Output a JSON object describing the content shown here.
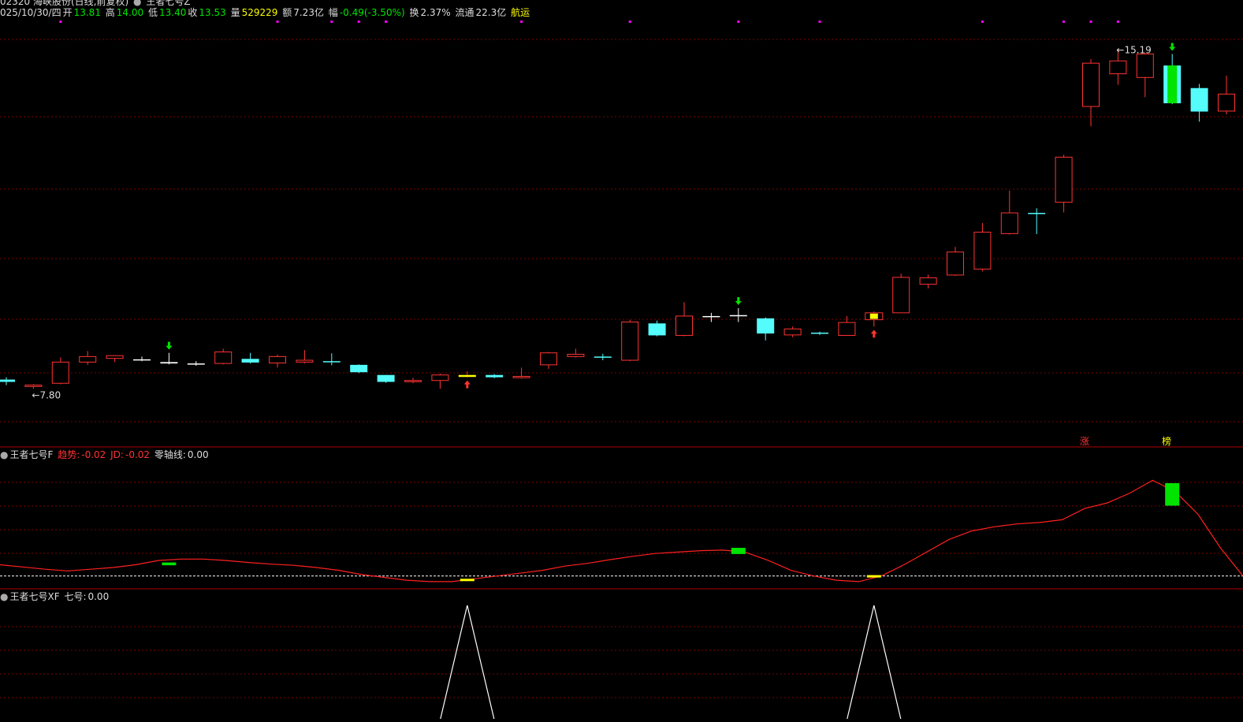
{
  "colors": {
    "up": "#ff3333",
    "down": "#54fcfc",
    "flat": "#ffffff",
    "green": "#00e400",
    "yellow": "#ffff00",
    "magenta": "#ff00ff",
    "grid": "#7a0000",
    "white": "#ffffff"
  },
  "header": {
    "code_title": "02320 海峡股份(日线,前复权)",
    "indicator_title": "王者七号Z",
    "date": "025/10/30/四",
    "open_label": "开",
    "open": "13.81",
    "high_label": "高",
    "high": "14.00",
    "low_label": "低",
    "low": "13.40",
    "close_label": "收",
    "close": "13.53",
    "vol_label": "量",
    "vol": "529229",
    "amt_label": "额",
    "amt": "7.23亿",
    "chg_label": "幅",
    "chg": "-0.49(-3.50%)",
    "turn_label": "换",
    "turn": "2.37%",
    "float_label": "流通",
    "float": "22.3亿",
    "sector": "航运"
  },
  "main_labels": {
    "max": "15.19",
    "min": "7.80",
    "tag1": "涨",
    "tag2": "榜"
  },
  "panel2": {
    "name": "王者七号F",
    "trend_label": "趋势:",
    "trend": "-0.02",
    "jd_label": "JD:",
    "jd": "-0.02",
    "zero_label": "零轴线:",
    "zero": "0.00"
  },
  "panel3": {
    "name": "王者七号XF",
    "qh_label": "七号:",
    "qh": "0.00"
  },
  "chart_data": {
    "type": "candlestick",
    "price_range": [
      7.0,
      15.9
    ],
    "candles": [
      {
        "o": 8.0,
        "h": 8.05,
        "l": 7.88,
        "c": 7.95,
        "color": "down"
      },
      {
        "o": 7.85,
        "h": 7.9,
        "l": 7.8,
        "c": 7.88,
        "color": "up"
      },
      {
        "o": 7.92,
        "h": 8.48,
        "l": 7.9,
        "c": 8.38,
        "color": "up"
      },
      {
        "o": 8.38,
        "h": 8.62,
        "l": 8.32,
        "c": 8.5,
        "color": "up"
      },
      {
        "o": 8.46,
        "h": 8.52,
        "l": 8.38,
        "c": 8.52,
        "color": "up"
      },
      {
        "o": 8.44,
        "h": 8.5,
        "l": 8.4,
        "c": 8.42,
        "color": "flat"
      },
      {
        "o": 8.38,
        "h": 8.58,
        "l": 8.33,
        "c": 8.35,
        "color": "green_cross"
      },
      {
        "o": 8.35,
        "h": 8.4,
        "l": 8.3,
        "c": 8.35,
        "color": "flat"
      },
      {
        "o": 8.35,
        "h": 8.67,
        "l": 8.33,
        "c": 8.6,
        "color": "up"
      },
      {
        "o": 8.45,
        "h": 8.58,
        "l": 8.35,
        "c": 8.37,
        "color": "down"
      },
      {
        "o": 8.36,
        "h": 8.54,
        "l": 8.26,
        "c": 8.5,
        "color": "up"
      },
      {
        "o": 8.38,
        "h": 8.64,
        "l": 8.35,
        "c": 8.42,
        "color": "up"
      },
      {
        "o": 8.4,
        "h": 8.57,
        "l": 8.31,
        "c": 8.38,
        "color": "down"
      },
      {
        "o": 8.32,
        "h": 8.33,
        "l": 8.14,
        "c": 8.16,
        "color": "down"
      },
      {
        "o": 8.1,
        "h": 8.1,
        "l": 7.93,
        "c": 7.95,
        "color": "down"
      },
      {
        "o": 7.96,
        "h": 8.04,
        "l": 7.92,
        "c": 7.98,
        "color": "up"
      },
      {
        "o": 7.98,
        "h": 8.13,
        "l": 7.8,
        "c": 8.1,
        "color": "up"
      },
      {
        "o": 8.07,
        "h": 8.18,
        "l": 8.05,
        "c": 8.1,
        "color": "yellow_doji"
      },
      {
        "o": 8.1,
        "h": 8.12,
        "l": 8.03,
        "c": 8.05,
        "color": "down"
      },
      {
        "o": 8.04,
        "h": 8.26,
        "l": 8.02,
        "c": 8.07,
        "color": "up"
      },
      {
        "o": 8.32,
        "h": 8.6,
        "l": 8.23,
        "c": 8.58,
        "color": "up"
      },
      {
        "o": 8.5,
        "h": 8.67,
        "l": 8.48,
        "c": 8.55,
        "color": "up"
      },
      {
        "o": 8.5,
        "h": 8.56,
        "l": 8.42,
        "c": 8.48,
        "color": "down"
      },
      {
        "o": 8.42,
        "h": 9.3,
        "l": 8.4,
        "c": 9.25,
        "color": "up"
      },
      {
        "o": 9.22,
        "h": 9.28,
        "l": 8.94,
        "c": 8.96,
        "color": "down"
      },
      {
        "o": 8.96,
        "h": 9.68,
        "l": 8.94,
        "c": 9.38,
        "color": "up"
      },
      {
        "o": 9.38,
        "h": 9.45,
        "l": 9.25,
        "c": 9.38,
        "color": "flat"
      },
      {
        "o": 9.4,
        "h": 9.55,
        "l": 9.25,
        "c": 9.4,
        "color": "green_cross"
      },
      {
        "o": 9.33,
        "h": 9.35,
        "l": 8.85,
        "c": 9.0,
        "color": "down"
      },
      {
        "o": 8.97,
        "h": 9.15,
        "l": 8.92,
        "c": 9.1,
        "color": "up"
      },
      {
        "o": 9.0,
        "h": 9.04,
        "l": 8.97,
        "c": 9.02,
        "color": "down"
      },
      {
        "o": 8.96,
        "h": 9.38,
        "l": 8.96,
        "c": 9.24,
        "color": "up"
      },
      {
        "o": 9.3,
        "h": 9.48,
        "l": 9.15,
        "c": 9.45,
        "color": "yellow_box"
      },
      {
        "o": 9.45,
        "h": 10.3,
        "l": 9.45,
        "c": 10.22,
        "color": "up"
      },
      {
        "o": 10.07,
        "h": 10.28,
        "l": 9.98,
        "c": 10.21,
        "color": "up"
      },
      {
        "o": 10.27,
        "h": 10.88,
        "l": 10.25,
        "c": 10.77,
        "color": "up"
      },
      {
        "o": 10.4,
        "h": 11.4,
        "l": 10.35,
        "c": 11.2,
        "color": "up"
      },
      {
        "o": 11.17,
        "h": 12.1,
        "l": 11.15,
        "c": 11.62,
        "color": "up"
      },
      {
        "o": 11.62,
        "h": 11.72,
        "l": 11.16,
        "c": 11.62,
        "color": "flat_cyan"
      },
      {
        "o": 11.85,
        "h": 12.88,
        "l": 11.63,
        "c": 12.83,
        "color": "up"
      },
      {
        "o": 13.93,
        "h": 14.96,
        "l": 13.5,
        "c": 14.87,
        "color": "up"
      },
      {
        "o": 14.64,
        "h": 15.19,
        "l": 14.4,
        "c": 14.92,
        "color": "up"
      },
      {
        "o": 14.56,
        "h": 15.1,
        "l": 14.13,
        "c": 15.07,
        "color": "up"
      },
      {
        "o": 14.82,
        "h": 15.07,
        "l": 13.98,
        "c": 14.0,
        "color": "green_big"
      },
      {
        "o": 14.33,
        "h": 14.42,
        "l": 13.6,
        "c": 13.82,
        "color": "down"
      },
      {
        "o": 13.83,
        "h": 14.6,
        "l": 13.76,
        "c": 14.2,
        "color": "up"
      }
    ],
    "top_dots_index": [
      2,
      10,
      12,
      13,
      14,
      19,
      23,
      27,
      30,
      36,
      39,
      40,
      41
    ],
    "down_arrows_index": [
      6,
      27,
      43
    ],
    "up_arrows_index": [
      17,
      32
    ],
    "osc_line": [
      0.04,
      0.032,
      0.024,
      0.018,
      0.024,
      0.03,
      0.04,
      0.055,
      0.06,
      0.06,
      0.055,
      0.048,
      0.042,
      0.038,
      0.03,
      0.02,
      0.005,
      -0.005,
      -0.015,
      -0.02,
      -0.02,
      -0.01,
      0.0,
      0.01,
      0.02,
      0.035,
      0.045,
      0.058,
      0.07,
      0.08,
      0.085,
      0.09,
      0.092,
      0.084,
      0.055,
      0.02,
      0.0,
      -0.015,
      -0.02,
      0.0,
      0.04,
      0.085,
      0.13,
      0.16,
      0.175,
      0.185,
      0.19,
      0.2,
      0.24,
      0.26,
      0.295,
      0.34,
      0.3,
      0.22,
      0.1,
      0.0
    ],
    "osc_range": [
      -0.04,
      0.4
    ],
    "osc_bars": [
      {
        "index": 6,
        "top": 0.048,
        "bottom": 0.038,
        "color": "green"
      },
      {
        "index": 17,
        "top": -0.01,
        "bottom": -0.018,
        "color": "yellow"
      },
      {
        "index": 27,
        "top": 0.1,
        "bottom": 0.078,
        "color": "green"
      },
      {
        "index": 32,
        "top": 0.003,
        "bottom": -0.003,
        "color": "yellow"
      },
      {
        "index": 43,
        "top": 0.33,
        "bottom": 0.25,
        "color": "green"
      }
    ],
    "spikes_index": [
      17,
      32
    ]
  }
}
